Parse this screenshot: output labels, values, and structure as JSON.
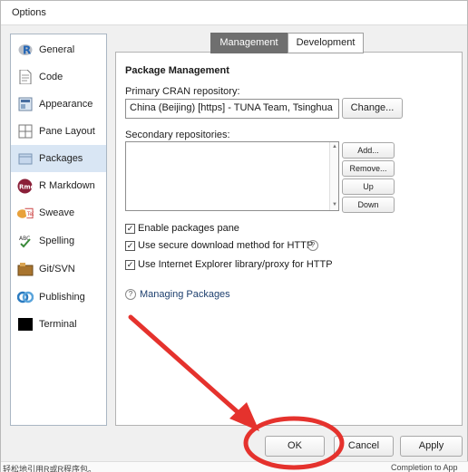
{
  "window": {
    "title": "Options"
  },
  "sidebar": {
    "items": [
      {
        "label": "General",
        "icon": "r-logo-icon"
      },
      {
        "label": "Code",
        "icon": "code-icon"
      },
      {
        "label": "Appearance",
        "icon": "appearance-icon"
      },
      {
        "label": "Pane Layout",
        "icon": "pane-layout-icon"
      },
      {
        "label": "Packages",
        "icon": "packages-icon",
        "selected": true
      },
      {
        "label": "R Markdown",
        "icon": "rmd-icon"
      },
      {
        "label": "Sweave",
        "icon": "sweave-icon"
      },
      {
        "label": "Spelling",
        "icon": "spelling-icon"
      },
      {
        "label": "Git/SVN",
        "icon": "git-icon"
      },
      {
        "label": "Publishing",
        "icon": "publishing-icon"
      },
      {
        "label": "Terminal",
        "icon": "terminal-icon"
      }
    ]
  },
  "tabs": [
    {
      "label": "Management",
      "active": true
    },
    {
      "label": "Development",
      "active": false
    }
  ],
  "packages": {
    "section_title": "Package Management",
    "cran_label": "Primary CRAN repository:",
    "cran_value": "China (Beijing) [https] - TUNA Team, Tsinghua",
    "change_button": "Change...",
    "secondary_label": "Secondary repositories:",
    "add_button": "Add...",
    "remove_button": "Remove...",
    "up_button": "Up",
    "down_button": "Down",
    "options": [
      {
        "label": "Enable packages pane",
        "checked": true
      },
      {
        "label": "Use secure download method for HTTP",
        "checked": true,
        "help": true
      },
      {
        "label": "Use Internet Explorer library/proxy for HTTP",
        "checked": true
      }
    ],
    "help_link": "Managing Packages"
  },
  "footer": {
    "ok": "OK",
    "cancel": "Cancel",
    "apply": "Apply"
  },
  "background_text": {
    "left": "轻松地引用R或R程序包。",
    "right": "Completion to App"
  },
  "annotation": {
    "color": "#e5322d"
  }
}
